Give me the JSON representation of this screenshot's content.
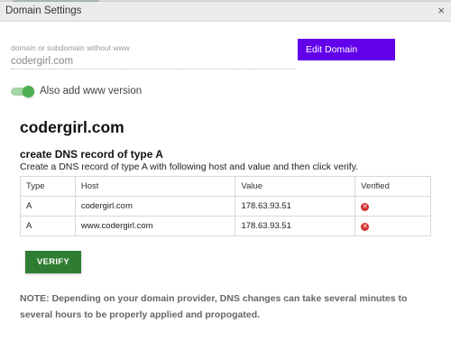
{
  "dialog": {
    "title": "Domain Settings",
    "close_label": "×"
  },
  "domain_field": {
    "label": "domain or subdomain without www",
    "value": "codergirl.com"
  },
  "edit_button": "Edit Domain",
  "www_toggle": {
    "label": "Also add www version",
    "on": true
  },
  "domain_heading": "codergirl.com",
  "dns": {
    "heading": "create DNS record of type A",
    "description": "Create a DNS record of type A with following host and value and then click verify.",
    "columns": [
      "Type",
      "Host",
      "Value",
      "Verified"
    ],
    "rows": [
      {
        "type": "A",
        "host": "codergirl.com",
        "value": "178.63.93.51",
        "verified_icon": "error-icon"
      },
      {
        "type": "A",
        "host": "www.codergirl.com",
        "value": "178.63.93.51",
        "verified_icon": "error-icon"
      }
    ]
  },
  "verify_button": "VERIFY",
  "note": "NOTE: Depending on your domain provider, DNS changes can take several minutes to several hours to be properly applied and propogated.",
  "colors": {
    "edit_button": "#6200ea",
    "verify_button": "#2e7d32",
    "toggle": "#4caf50",
    "error": "#d32f2f"
  }
}
